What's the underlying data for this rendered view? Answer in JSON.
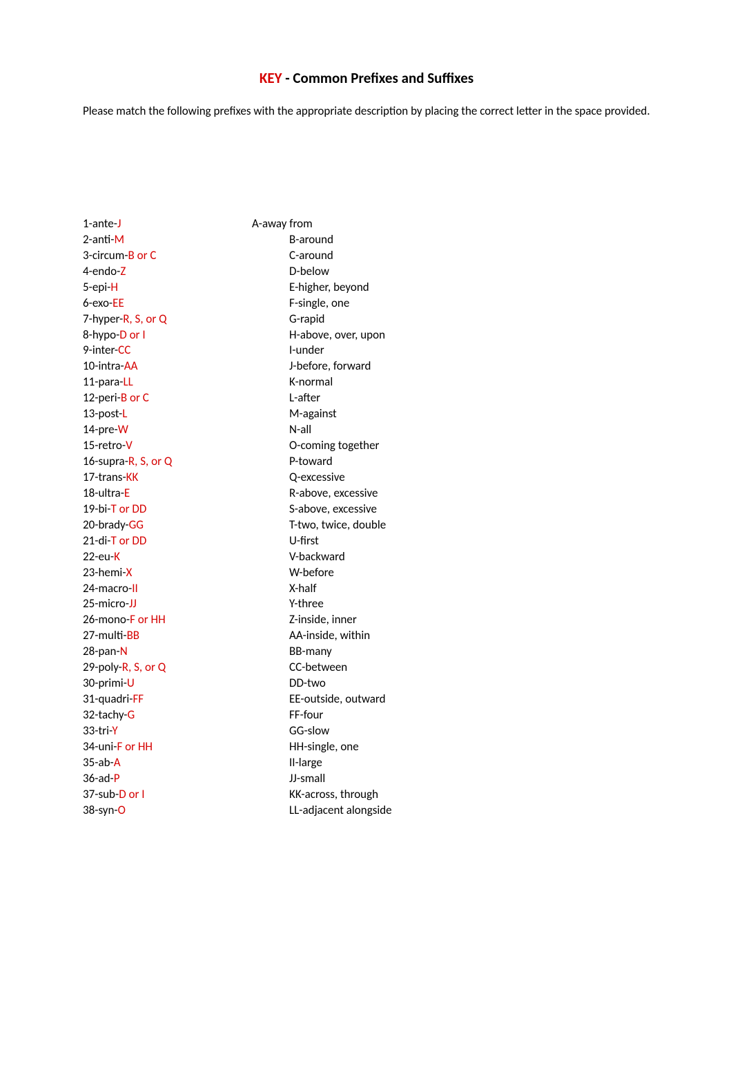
{
  "title": {
    "key": "KEY",
    "rest": " - Common Prefixes and Suffixes"
  },
  "instructions": "Please match the following prefixes with the appropriate description by placing the correct letter in the space provided.",
  "left": [
    {
      "num": "1",
      "prefix": "ante",
      "answer": "J"
    },
    {
      "num": "2",
      "prefix": "anti",
      "answer": "M"
    },
    {
      "num": "3",
      "prefix": "circum",
      "answer": "B or C"
    },
    {
      "num": "4",
      "prefix": "endo",
      "answer": "Z"
    },
    {
      "num": "5",
      "prefix": "epi",
      "answer": "H"
    },
    {
      "num": "6",
      "prefix": "exo",
      "answer": "EE"
    },
    {
      "num": "7",
      "prefix": "hyper",
      "answer": "R, S, or Q"
    },
    {
      "num": "8",
      "prefix": "hypo",
      "answer": "D or I"
    },
    {
      "num": "9",
      "prefix": "inter",
      "answer": "CC"
    },
    {
      "num": "10",
      "prefix": "intra",
      "answer": "AA"
    },
    {
      "num": "11",
      "prefix": "para",
      "answer": "LL"
    },
    {
      "num": "12",
      "prefix": "peri",
      "answer": "B or C"
    },
    {
      "num": "13",
      "prefix": "post",
      "answer": "L"
    },
    {
      "num": "14",
      "prefix": "pre",
      "answer": "W"
    },
    {
      "num": "15",
      "prefix": "retro",
      "answer": "V"
    },
    {
      "num": "16",
      "prefix": "supra",
      "answer": "R, S, or Q"
    },
    {
      "num": "17",
      "prefix": "trans",
      "answer": "KK"
    },
    {
      "num": "18",
      "prefix": "ultra",
      "answer": "E"
    },
    {
      "num": "19",
      "prefix": "bi",
      "answer": "T or DD"
    },
    {
      "num": "20",
      "prefix": "brady",
      "answer": "GG"
    },
    {
      "num": "21",
      "prefix": "di",
      "answer": "T or DD"
    },
    {
      "num": "22",
      "prefix": "eu",
      "answer": "K"
    },
    {
      "num": "23",
      "prefix": "hemi",
      "answer": "X"
    },
    {
      "num": "24",
      "prefix": "macro",
      "answer": "II"
    },
    {
      "num": "25",
      "prefix": "micro",
      "answer": "JJ"
    },
    {
      "num": "26",
      "prefix": "mono",
      "answer": "F or HH"
    },
    {
      "num": "27",
      "prefix": "multi",
      "answer": "BB"
    },
    {
      "num": "28",
      "prefix": "pan",
      "answer": "N"
    },
    {
      "num": "29",
      "prefix": "poly",
      "answer": "R, S, or Q"
    },
    {
      "num": "30",
      "prefix": "primi",
      "answer": "U"
    },
    {
      "num": "31",
      "prefix": "quadri",
      "answer": "FF"
    },
    {
      "num": "32",
      "prefix": "tachy",
      "answer": "G"
    },
    {
      "num": "33",
      "prefix": "tri",
      "answer": "Y"
    },
    {
      "num": "34",
      "prefix": "uni",
      "answer": "F or HH"
    },
    {
      "num": "35",
      "prefix": "ab",
      "answer": "A"
    },
    {
      "num": "36",
      "prefix": "ad",
      "answer": "P"
    },
    {
      "num": "37",
      "prefix": "sub",
      "answer": "D or I"
    },
    {
      "num": "38",
      "prefix": "syn",
      "answer": "O"
    }
  ],
  "right": [
    {
      "letter": "A",
      "desc": "away from",
      "first": true
    },
    {
      "letter": "B",
      "desc": "around"
    },
    {
      "letter": "C",
      "desc": "around"
    },
    {
      "letter": "D",
      "desc": "below"
    },
    {
      "letter": "E",
      "desc": "higher, beyond"
    },
    {
      "letter": "F",
      "desc": "single, one"
    },
    {
      "letter": "G",
      "desc": "rapid"
    },
    {
      "letter": "H",
      "desc": "above, over, upon"
    },
    {
      "letter": "I",
      "desc": "under"
    },
    {
      "letter": "J",
      "desc": "before, forward"
    },
    {
      "letter": "K",
      "desc": "normal"
    },
    {
      "letter": "L",
      "desc": "after"
    },
    {
      "letter": "M",
      "desc": "against"
    },
    {
      "letter": "N",
      "desc": "all"
    },
    {
      "letter": "O",
      "desc": "coming together"
    },
    {
      "letter": "P",
      "desc": "toward"
    },
    {
      "letter": "Q",
      "desc": "excessive"
    },
    {
      "letter": "R",
      "desc": "above, excessive"
    },
    {
      "letter": "S",
      "desc": "above, excessive"
    },
    {
      "letter": "T",
      "desc": "two, twice, double"
    },
    {
      "letter": "U",
      "desc": "first"
    },
    {
      "letter": "V",
      "desc": "backward"
    },
    {
      "letter": "W",
      "desc": "before"
    },
    {
      "letter": "X",
      "desc": "half"
    },
    {
      "letter": "Y",
      "desc": "three"
    },
    {
      "letter": "Z",
      "desc": "inside, inner"
    },
    {
      "letter": "AA",
      "desc": "inside, within"
    },
    {
      "letter": "BB",
      "desc": "many"
    },
    {
      "letter": "CC",
      "desc": "between"
    },
    {
      "letter": "DD",
      "desc": "two"
    },
    {
      "letter": "EE",
      "desc": "outside, outward"
    },
    {
      "letter": "FF",
      "desc": "four"
    },
    {
      "letter": "GG",
      "desc": "slow"
    },
    {
      "letter": "HH",
      "desc": "single, one"
    },
    {
      "letter": "II",
      "desc": "large"
    },
    {
      "letter": "JJ",
      "desc": "small"
    },
    {
      "letter": "KK",
      "desc": "across, through"
    },
    {
      "letter": "LL",
      "desc": "adjacent alongside"
    }
  ]
}
